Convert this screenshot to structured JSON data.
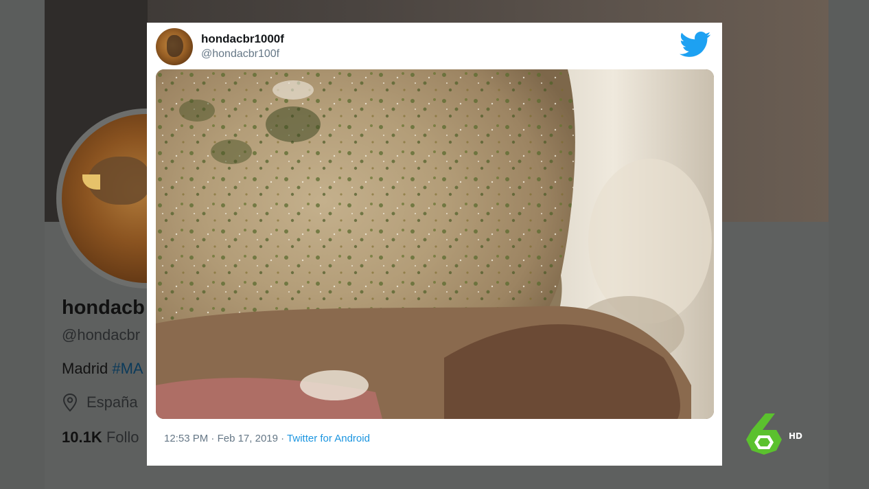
{
  "background_profile": {
    "name": "hondacb",
    "handle": "@hondacbr",
    "bio_text": "Madrid",
    "bio_hashtag": "#MA",
    "location": "España",
    "followers_count": "10.1K",
    "followers_label": "Follo",
    "location_icon": "map-pin-icon"
  },
  "tweet": {
    "display_name": "hondacbr1000f",
    "handle": "@hondacbr100f",
    "brand_icon": "twitter-bird-icon",
    "brand_color": "#1da1f2",
    "media_description_icon": "food-photo",
    "time": "12:53 PM",
    "separator": "·",
    "date": "Feb 17, 2019",
    "source": "Twitter for Android",
    "source_color": "#1b95e0"
  },
  "channel": {
    "logo_icon": "la-sexta-logo-icon",
    "logo_color": "#5bc12e",
    "quality_label": "HD"
  }
}
